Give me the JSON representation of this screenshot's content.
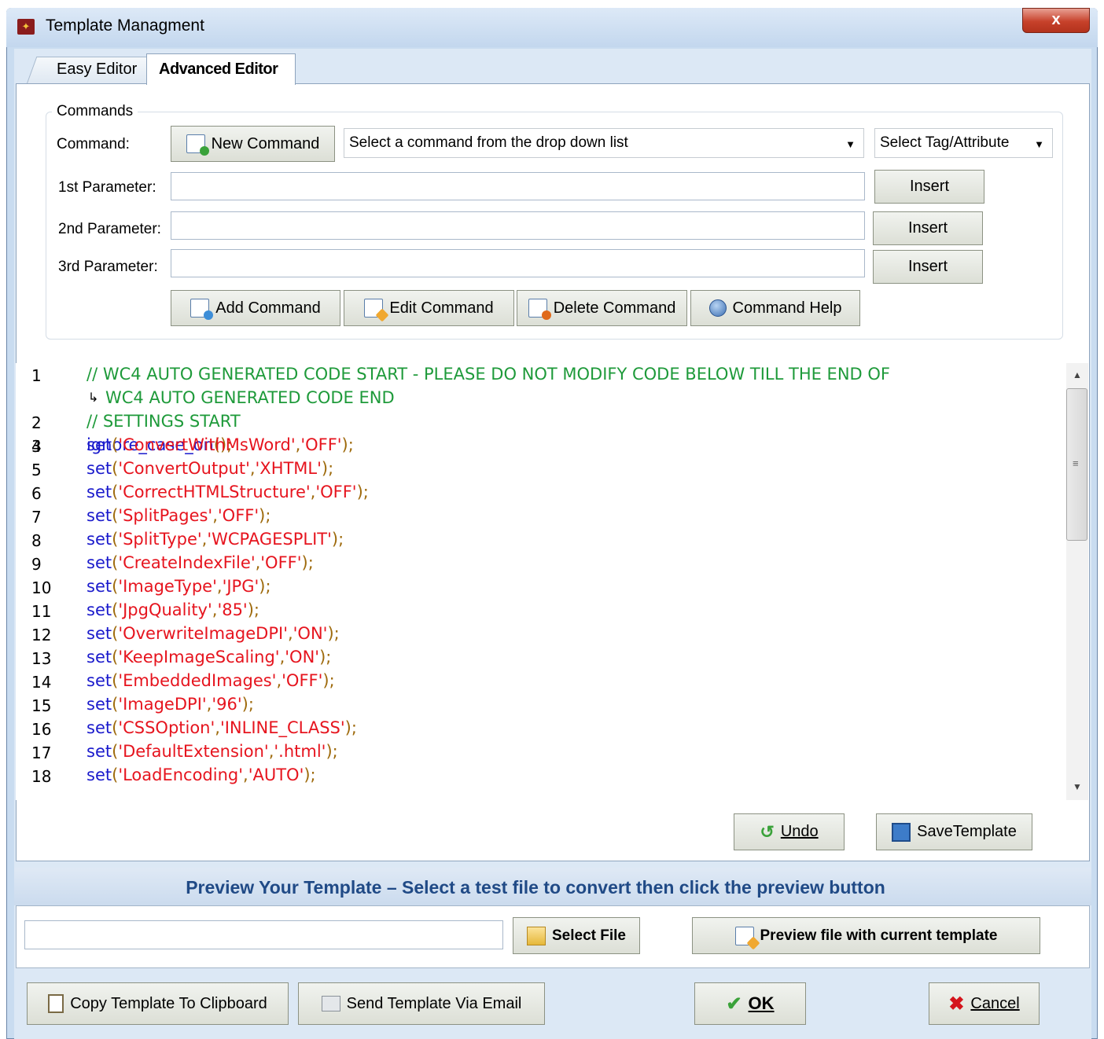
{
  "window": {
    "title": "Template Managment",
    "close_label": "x"
  },
  "tabs": [
    {
      "label": "Easy Editor"
    },
    {
      "label": "Advanced Editor"
    }
  ],
  "commands": {
    "group_title": "Commands",
    "command_label": "Command:",
    "new_command_label": "New Command",
    "command_select_value": "Select a command from the drop down list",
    "tag_select_value": "Select Tag/Attribute",
    "param1_label": "1st Parameter:",
    "param2_label": "2nd Parameter:",
    "param3_label": "3rd Parameter:",
    "param1_value": "",
    "param2_value": "",
    "param3_value": "",
    "insert_label": "Insert",
    "add_command_label": "Add Command",
    "edit_command_label": "Edit Command",
    "delete_command_label": "Delete Command",
    "command_help_label": "Command Help"
  },
  "code": {
    "line1_comment_a": "// WC4 AUTO GENERATED CODE START - PLEASE DO NOT MODIFY CODE BELOW TILL THE END OF",
    "line1_comment_b": "WC4 AUTO GENERATED CODE END",
    "line2_comment": "// SETTINGS START",
    "line3_fn": "ignore_case_on",
    "line3_rest": "();",
    "set_fn": "set",
    "lines": [
      {
        "num": "1"
      },
      {
        "num": "2"
      },
      {
        "num": "3"
      },
      {
        "num": "4",
        "key": "'ConvertWithMsWord'",
        "val": "'OFF'"
      },
      {
        "num": "5",
        "key": "'ConvertOutput'",
        "val": "'XHTML'"
      },
      {
        "num": "6",
        "key": "'CorrectHTMLStructure'",
        "val": "'OFF'"
      },
      {
        "num": "7",
        "key": "'SplitPages'",
        "val": "'OFF'"
      },
      {
        "num": "8",
        "key": "'SplitType'",
        "val": "'WCPAGESPLIT'"
      },
      {
        "num": "9",
        "key": "'CreateIndexFile'",
        "val": "'OFF'"
      },
      {
        "num": "10",
        "key": "'ImageType'",
        "val": "'JPG'"
      },
      {
        "num": "11",
        "key": "'JpgQuality'",
        "val": "'85'"
      },
      {
        "num": "12",
        "key": "'OverwriteImageDPI'",
        "val": "'ON'"
      },
      {
        "num": "13",
        "key": "'KeepImageScaling'",
        "val": "'ON'"
      },
      {
        "num": "14",
        "key": "'EmbeddedImages'",
        "val": "'OFF'"
      },
      {
        "num": "15",
        "key": "'ImageDPI'",
        "val": "'96'"
      },
      {
        "num": "16",
        "key": "'CSSOption'",
        "val": "'INLINE_CLASS'"
      },
      {
        "num": "17",
        "key": "'DefaultExtension'",
        "val": "'.html'"
      },
      {
        "num": "18",
        "key": "'LoadEncoding'",
        "val": "'AUTO'"
      }
    ]
  },
  "editor_actions": {
    "undo_label": "Undo",
    "save_label": "SaveTemplate"
  },
  "preview": {
    "title": "Preview Your Template – Select a test file to convert then click the preview button",
    "file_value": "",
    "select_file_label": "Select File",
    "preview_button_label": "Preview file with current template"
  },
  "footer": {
    "copy_label": "Copy Template To Clipboard",
    "email_label": "Send Template Via Email",
    "ok_label": "OK",
    "cancel_label": "Cancel"
  }
}
